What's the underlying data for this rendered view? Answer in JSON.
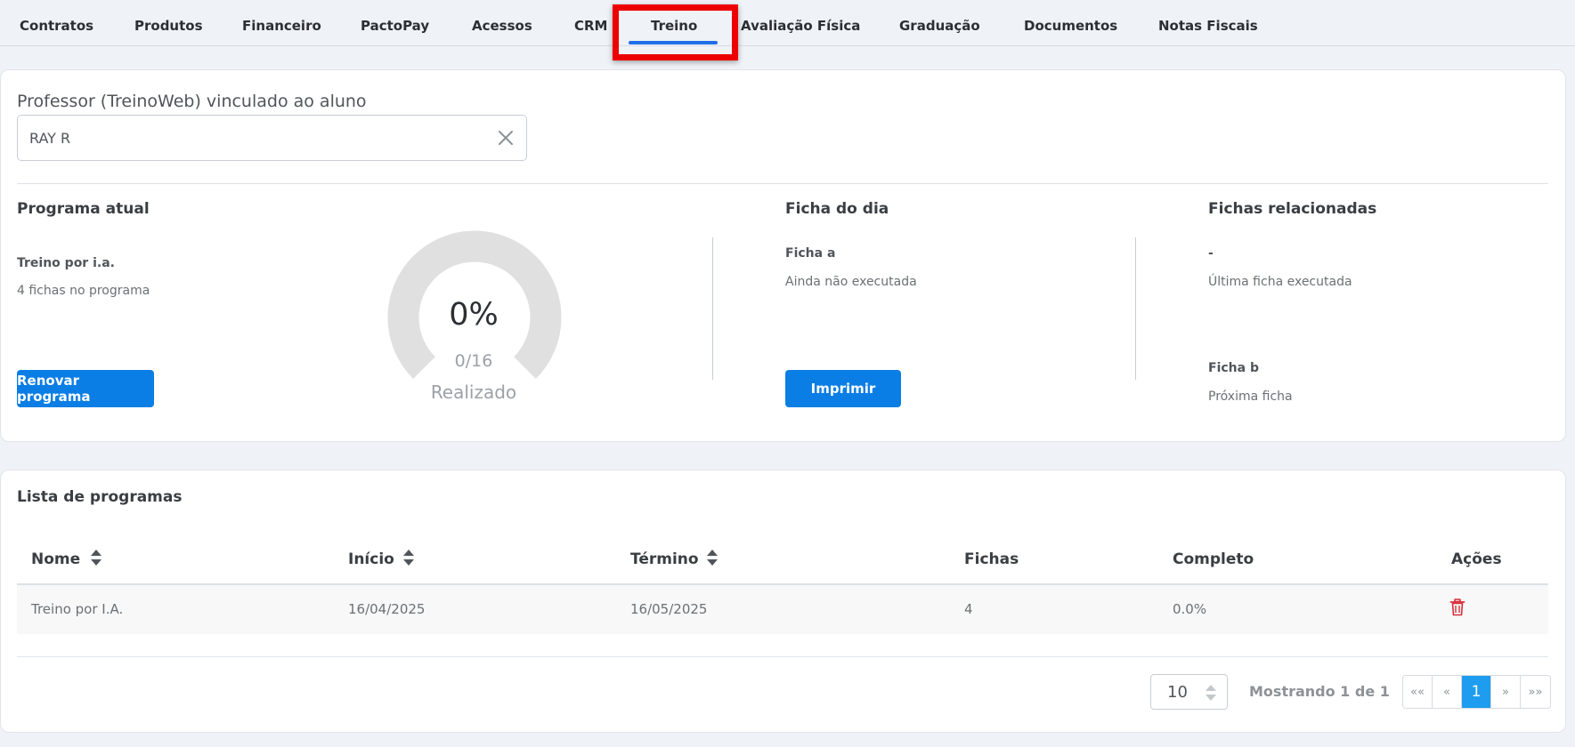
{
  "tabs": [
    {
      "label": "Contratos"
    },
    {
      "label": "Produtos"
    },
    {
      "label": "Financeiro"
    },
    {
      "label": "PactoPay"
    },
    {
      "label": "Acessos"
    },
    {
      "label": "CRM"
    },
    {
      "label": "Treino",
      "active": true
    },
    {
      "label": "Avaliação Física"
    },
    {
      "label": "Graduação"
    },
    {
      "label": "Documentos"
    },
    {
      "label": "Notas Fiscais"
    }
  ],
  "colors": {
    "accent": "#0a7ee5",
    "tab_active": "#1f6ee8",
    "highlight": "#ec0000",
    "delete": "#d62e3b",
    "page_active": "#1e9cf0"
  },
  "professor": {
    "label": "Professor (TreinoWeb) vinculado ao aluno",
    "value": "RAY R"
  },
  "programa_atual": {
    "title": "Programa atual",
    "name": "Treino por i.a.",
    "fichas": "4 fichas  no programa",
    "renew_button": "Renovar programa"
  },
  "progress": {
    "percent_text": "0%",
    "count_text": "0/16",
    "label": "Realizado",
    "fraction": 0
  },
  "ficha_do_dia": {
    "title": "Ficha do dia",
    "name": "Ficha a",
    "status": "Ainda não executada",
    "print_button": "Imprimir"
  },
  "fichas_relacionadas": {
    "title": "Fichas relacionadas",
    "last_value": "-",
    "last_label": "Última ficha executada",
    "next_value": "Ficha b",
    "next_label": "Próxima ficha"
  },
  "lista": {
    "title": "Lista de programas",
    "columns": [
      "Nome",
      "Início",
      "Término",
      "Fichas",
      "Completo",
      "Ações"
    ],
    "rows": [
      {
        "nome": "Treino por I.A.",
        "inicio": "16/04/2025",
        "termino": "16/05/2025",
        "fichas": "4",
        "completo": "0.0%"
      }
    ]
  },
  "pagination": {
    "page_size": "10",
    "showing": "Mostrando 1 de 1",
    "first": "««",
    "prev": "«",
    "current": "1",
    "next": "»",
    "last": "»»"
  }
}
